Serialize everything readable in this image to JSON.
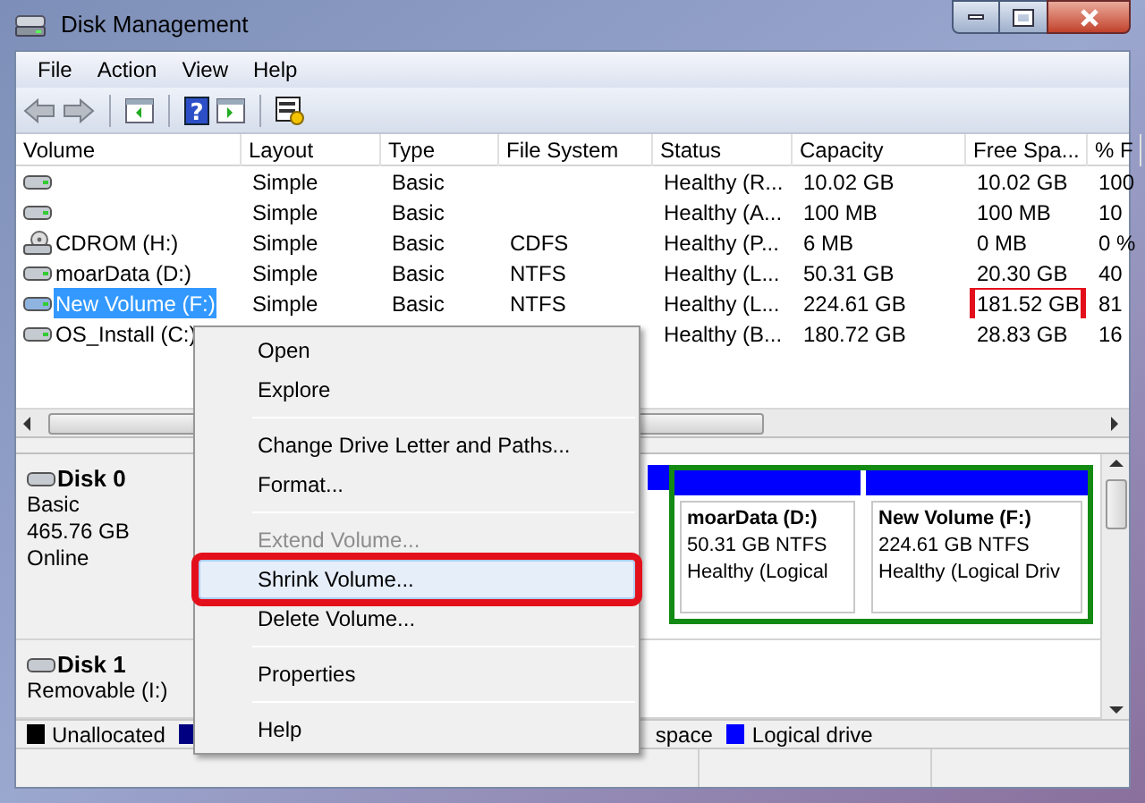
{
  "window": {
    "title": "Disk Management"
  },
  "menu_bar": [
    "File",
    "Action",
    "View",
    "Help"
  ],
  "toolbar": {
    "help_glyph": "?"
  },
  "table": {
    "columns": [
      "Volume",
      "Layout",
      "Type",
      "File System",
      "Status",
      "Capacity",
      "Free Spa...",
      "% F"
    ],
    "rows": [
      {
        "volume": "",
        "kind": "disk",
        "layout": "Simple",
        "type": "Basic",
        "file_system": "",
        "status": "Healthy (R...",
        "capacity": "10.02 GB",
        "free_space": "10.02 GB",
        "column_8": "100",
        "selected": false,
        "highlighted": false
      },
      {
        "volume": "",
        "kind": "disk",
        "layout": "Simple",
        "type": "Basic",
        "file_system": "",
        "status": "Healthy (A...",
        "capacity": "100 MB",
        "free_space": "100 MB",
        "column_8": "10",
        "selected": false,
        "highlighted": false
      },
      {
        "volume": "CDROM (H:)",
        "kind": "cdrom",
        "layout": "Simple",
        "type": "Basic",
        "file_system": "CDFS",
        "status": "Healthy (P...",
        "capacity": "6 MB",
        "free_space": "0 MB",
        "column_8": "0 %",
        "selected": false,
        "highlighted": false
      },
      {
        "volume": "moarData (D:)",
        "kind": "disk",
        "layout": "Simple",
        "type": "Basic",
        "file_system": "NTFS",
        "status": "Healthy (L...",
        "capacity": "50.31 GB",
        "free_space": "20.30 GB",
        "column_8": "40",
        "selected": false,
        "highlighted": false
      },
      {
        "volume": "New Volume (F:)",
        "kind": "disk",
        "layout": "Simple",
        "type": "Basic",
        "file_system": "NTFS",
        "status": "Healthy (L...",
        "capacity": "224.61 GB",
        "free_space": "181.52 GB",
        "column_8": "81",
        "selected": true,
        "highlighted": true
      },
      {
        "volume": "OS_Install (C:)",
        "kind": "disk",
        "layout": "",
        "type": "",
        "file_system": "",
        "status": "Healthy (B...",
        "capacity": "180.72 GB",
        "free_space": "28.83 GB",
        "column_8": "16",
        "selected": false,
        "highlighted": false
      }
    ]
  },
  "disks": [
    {
      "name": "Disk 0",
      "lines": [
        "Basic",
        "465.76 GB",
        "Online"
      ],
      "partitions": [
        {
          "name": "moarData  (D:)",
          "size": "50.31 GB NTFS",
          "status": "Healthy (Logical"
        },
        {
          "name": "New Volume  (F:)",
          "size": "224.61 GB NTFS",
          "status": "Healthy (Logical Driv"
        }
      ]
    },
    {
      "name": "Disk 1",
      "lines": [
        "Removable (I:)"
      ]
    }
  ],
  "legend": [
    {
      "label": "Unallocated",
      "color": "#000000"
    },
    {
      "color": "#000080"
    },
    {
      "label": "space"
    },
    {
      "label": "Logical drive",
      "color": "#0000ff"
    }
  ],
  "context_menu": [
    {
      "kind": "item",
      "label": "Open",
      "disabled": false,
      "selected": false,
      "highlighted": false
    },
    {
      "kind": "item",
      "label": "Explore",
      "disabled": false,
      "selected": false,
      "highlighted": false
    },
    {
      "kind": "separator"
    },
    {
      "kind": "item",
      "label": "Change Drive Letter and Paths...",
      "disabled": false,
      "selected": false,
      "highlighted": false
    },
    {
      "kind": "item",
      "label": "Format...",
      "disabled": false,
      "selected": false,
      "highlighted": false
    },
    {
      "kind": "separator"
    },
    {
      "kind": "item",
      "label": "Extend Volume...",
      "disabled": true,
      "selected": false,
      "highlighted": false
    },
    {
      "kind": "item",
      "label": "Shrink Volume...",
      "disabled": false,
      "selected": true,
      "highlighted": true
    },
    {
      "kind": "item",
      "label": "Delete Volume...",
      "disabled": false,
      "selected": false,
      "highlighted": false
    },
    {
      "kind": "separator"
    },
    {
      "kind": "item",
      "label": "Properties",
      "disabled": false,
      "selected": false,
      "highlighted": false
    },
    {
      "kind": "separator"
    },
    {
      "kind": "item",
      "label": "Help",
      "disabled": false,
      "selected": false,
      "highlighted": false
    }
  ]
}
